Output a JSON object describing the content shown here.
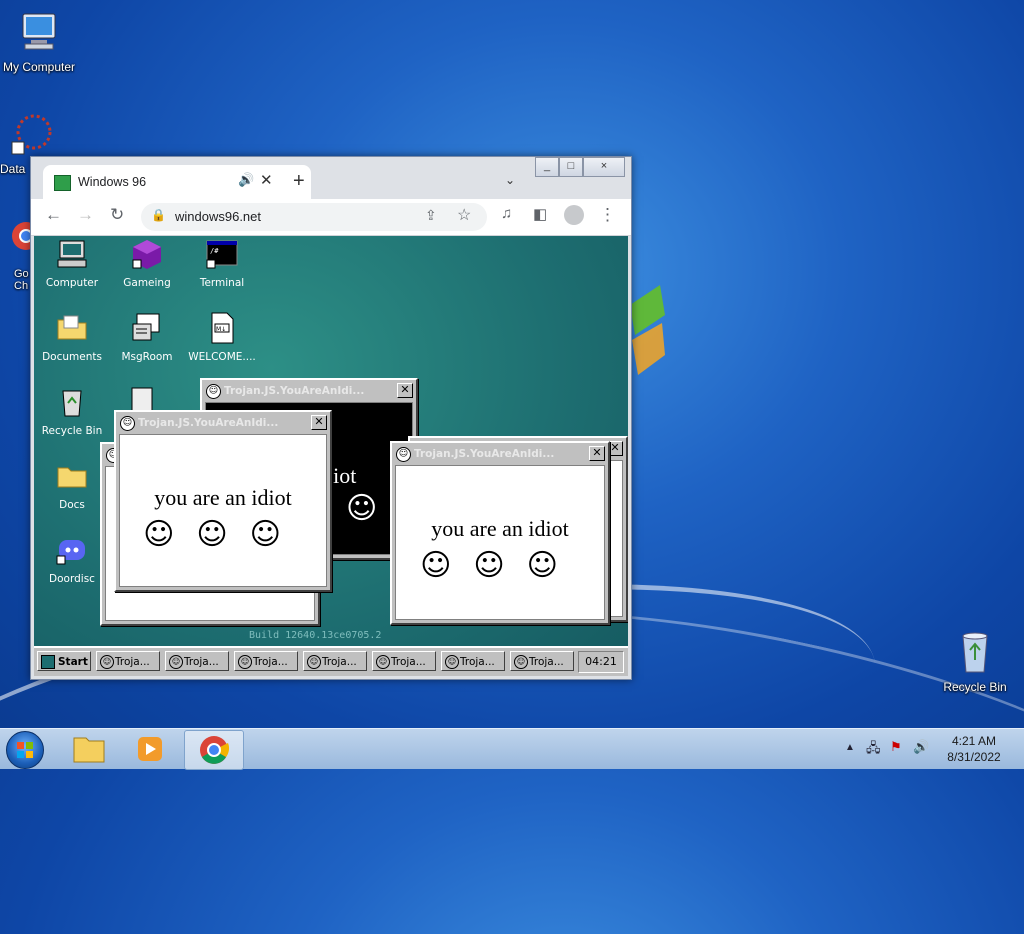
{
  "desktop": {
    "icons": [
      {
        "label": "My Computer",
        "icon": "computer-icon"
      },
      {
        "label": "Data",
        "icon": "data-shortcut-icon"
      },
      {
        "label": "Go\nCh",
        "icon": "chrome-shortcut-icon"
      },
      {
        "label": "Recycle Bin",
        "icon": "recycle-bin-icon"
      }
    ]
  },
  "browser": {
    "tab_title": "Windows 96",
    "url": "windows96.net",
    "new_tab": "+",
    "window_buttons": [
      "_",
      "□",
      "×"
    ]
  },
  "w96": {
    "icons": [
      {
        "label": "Computer"
      },
      {
        "label": "Gameing"
      },
      {
        "label": "Terminal"
      },
      {
        "label": "Documents"
      },
      {
        "label": "MsgRoom"
      },
      {
        "label": "WELCOME...."
      },
      {
        "label": "Recycle Bin"
      },
      {
        "label": "Docs"
      },
      {
        "label": "Doordisc"
      }
    ],
    "build": "Build 12640.13ce0705.2",
    "dialogs": {
      "title": "Trojan.JS.YouAreAnIdi...",
      "message": "you are an idiot",
      "message_partial": "idiot",
      "smiles": "☺☺☺"
    },
    "taskbar": {
      "start": "Start",
      "items": [
        "Troja...",
        "Troja...",
        "Troja...",
        "Troja...",
        "Troja...",
        "Troja...",
        "Troja..."
      ],
      "clock": "04:21"
    }
  },
  "win7_taskbar": {
    "time": "4:21 AM",
    "date": "8/31/2022"
  },
  "colors": {
    "w96_teal": "#1d6d70",
    "win96_gray": "#c0c0c0",
    "desktop_blue": "#1f63c4"
  }
}
